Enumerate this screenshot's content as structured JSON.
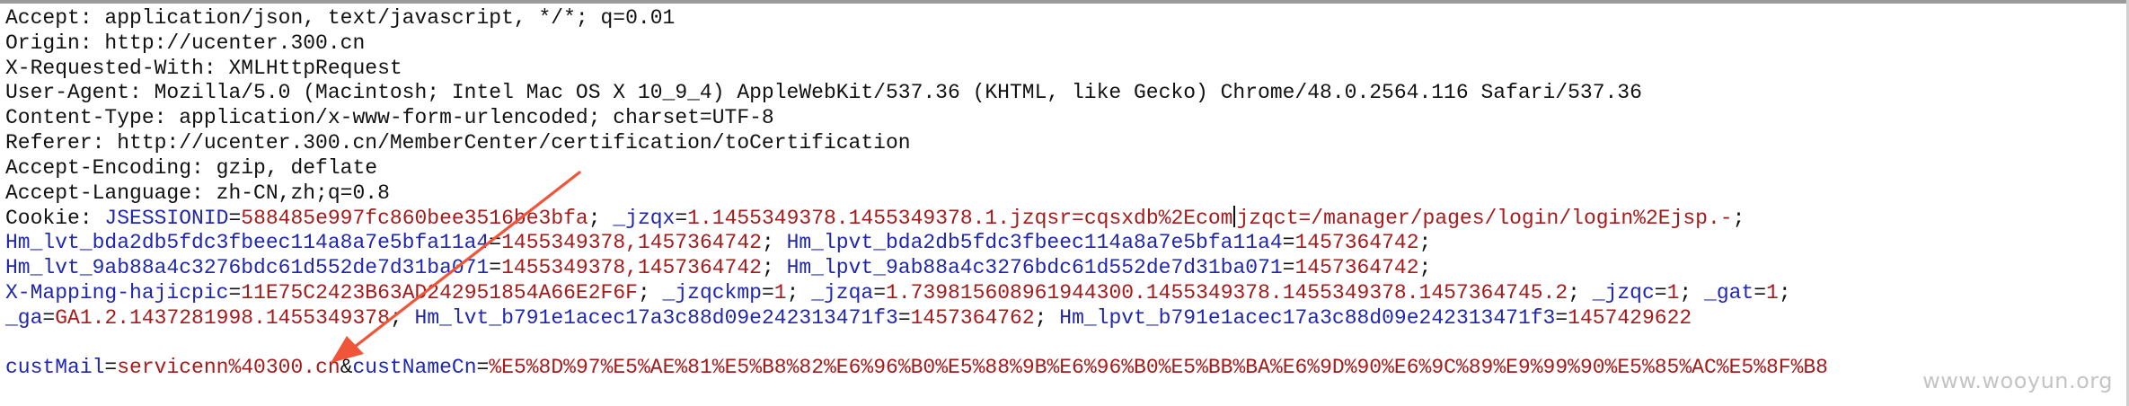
{
  "headers": [
    {
      "text": "Accept: application/json, text/javascript, */*; q=0.01"
    },
    {
      "text": "Origin: http://ucenter.300.cn"
    },
    {
      "text": "X-Requested-With: XMLHttpRequest"
    },
    {
      "text": "User-Agent: Mozilla/5.0 (Macintosh; Intel Mac OS X 10_9_4) AppleWebKit/537.36 (KHTML, like Gecko) Chrome/48.0.2564.116 Safari/537.36"
    },
    {
      "text": "Content-Type: application/x-www-form-urlencoded; charset=UTF-8"
    },
    {
      "text": "Referer: http://ucenter.300.cn/MemberCenter/certification/toCertification"
    },
    {
      "text": "Accept-Encoding: gzip, deflate"
    },
    {
      "text": "Accept-Language: zh-CN,zh;q=0.8"
    }
  ],
  "cookie_label": "Cookie: ",
  "cookie_lines": [
    [
      {
        "key": "JSESSIONID",
        "eq": "=",
        "val": "588485e997fc860bee3516be3bfa",
        "sep": "; "
      },
      {
        "key": "_jzqx",
        "eq": "=",
        "val": "1.1455349378.1455349378.1.jzqsr=cqsxdb%2Ecom",
        "sep": ""
      },
      {
        "caret": true
      },
      {
        "key": "",
        "eq": "",
        "val": "jzqct=/manager/pages/login/login%2Ejsp.-",
        "sep": ";"
      }
    ],
    [
      {
        "key": "Hm_lvt_bda2db5fdc3fbeec114a8a7e5bfa11a4",
        "eq": "=",
        "val": "1455349378,1457364742",
        "sep": "; "
      },
      {
        "key": "Hm_lpvt_bda2db5fdc3fbeec114a8a7e5bfa11a4",
        "eq": "=",
        "val": "1457364742",
        "sep": ";"
      }
    ],
    [
      {
        "key": "Hm_lvt_9ab88a4c3276bdc61d552de7d31ba071",
        "eq": "=",
        "val": "1455349378,1457364742",
        "sep": "; "
      },
      {
        "key": "Hm_lpvt_9ab88a4c3276bdc61d552de7d31ba071",
        "eq": "=",
        "val": "1457364742",
        "sep": ";"
      }
    ],
    [
      {
        "key": "X-Mapping-hajicpic",
        "eq": "=",
        "val": "11E75C2423B63AD242951854A66E2F6F",
        "sep": "; "
      },
      {
        "key": "_jzqckmp",
        "eq": "=",
        "val": "1",
        "sep": "; "
      },
      {
        "key": "_jzqa",
        "eq": "=",
        "val": "1.739815608961944300.1455349378.1455349378.1457364745.2",
        "sep": "; "
      },
      {
        "key": "_jzqc",
        "eq": "=",
        "val": "1",
        "sep": "; "
      },
      {
        "key": "_gat",
        "eq": "=",
        "val": "1",
        "sep": ";"
      }
    ],
    [
      {
        "key": "_ga",
        "eq": "=",
        "val": "GA1.2.1437281998.1455349378",
        "sep": "; "
      },
      {
        "key": "Hm_lvt_b791e1acec17a3c88d09e242313471f3",
        "eq": "=",
        "val": "1457364762",
        "sep": "; "
      },
      {
        "key": "Hm_lpvt_b791e1acec17a3c88d09e242313471f3",
        "eq": "=",
        "val": "1457429622",
        "sep": ""
      }
    ]
  ],
  "body_params": [
    {
      "key": "custMail",
      "eq": "=",
      "val": "servicenn%40300.cn",
      "sep": "&"
    },
    {
      "key": "custNameCn",
      "eq": "=",
      "val": "%E5%8D%97%E5%AE%81%E5%B8%82%E6%96%B0%E5%88%9B%E6%96%B0%E5%BB%BA%E6%9D%90%E6%9C%89%E9%99%90%E5%85%AC%E5%8F%B8",
      "sep": ""
    }
  ],
  "watermark": "www.wooyun.org",
  "colors": {
    "key": "#1f26b0",
    "value": "#a61a1a",
    "text": "#111111",
    "arrow": "#f0553a"
  }
}
